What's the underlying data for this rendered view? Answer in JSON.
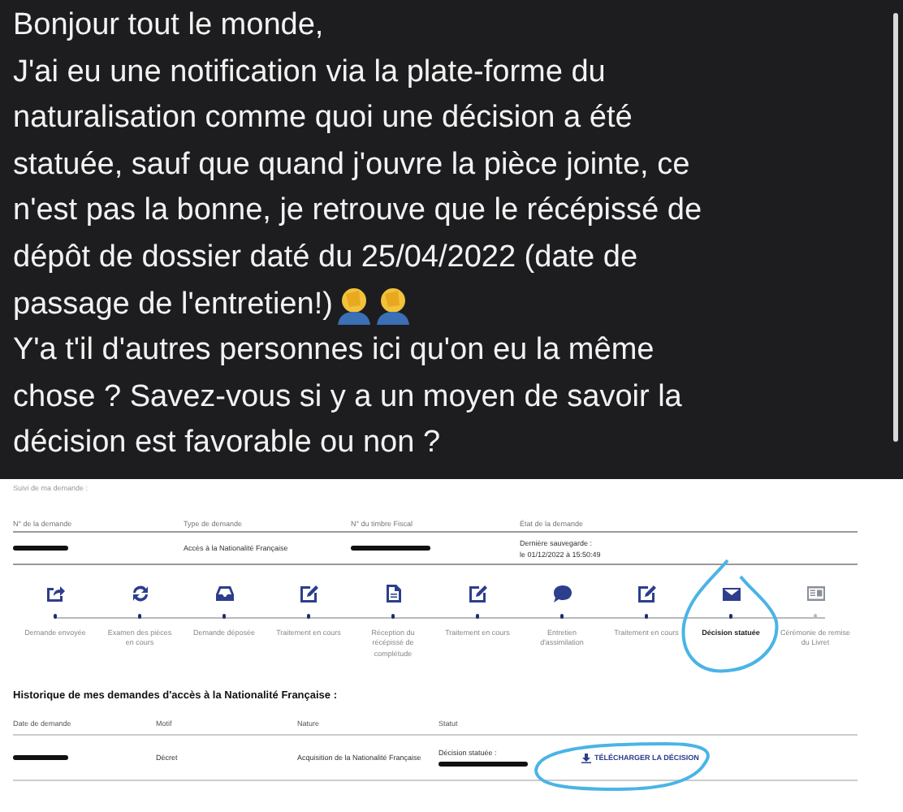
{
  "post": {
    "paragraphs": [
      [
        "Bonjour tout le monde,",
        "J'ai eu une notification via la plate-forme du",
        "naturalisation comme quoi une décision a été",
        "statuée, sauf que quand j'ouvre la pièce jointe, ce",
        "n'est pas la bonne, je retrouve que le récépissé de",
        "dépôt de dossier daté du 25/04/2022 (date de",
        "passage de l'entretien!)"
      ],
      [
        "Y'a t'il d'autres personnes ici qu'on eu la même",
        "chose ? Savez-vous si y a un moyen de savoir la",
        "décision est favorable ou non ?"
      ]
    ]
  },
  "tracking": {
    "title": "Suivi de ma demande :",
    "columns": [
      "N° de la demande",
      "Type de demande",
      "N° du timbre Fiscal",
      "État de la demande"
    ],
    "values": {
      "type": "Accès à la Nationalité Française",
      "state_label": "Dernière sauvegarde :",
      "state_value": "le 01/12/2022 à 15:50:49"
    },
    "steps": [
      {
        "kind": "share",
        "label": "Demande envoyée",
        "done": true,
        "selected": false
      },
      {
        "kind": "sync",
        "label": "Examen des pièces en cours",
        "done": true,
        "selected": false
      },
      {
        "kind": "inbox",
        "label": "Demande déposée",
        "done": true,
        "selected": false
      },
      {
        "kind": "edit",
        "label": "Traitement en cours",
        "done": true,
        "selected": false
      },
      {
        "kind": "document",
        "label": "Réception du récépissé de complétude",
        "done": true,
        "selected": false
      },
      {
        "kind": "edit",
        "label": "Traitement en cours",
        "done": true,
        "selected": false
      },
      {
        "kind": "chat",
        "label": "Entretien d'assimilation",
        "done": true,
        "selected": false
      },
      {
        "kind": "edit",
        "label": "Traitement en cours",
        "done": true,
        "selected": false
      },
      {
        "kind": "mail",
        "label": "Décision statuée",
        "done": true,
        "selected": true
      },
      {
        "kind": "card",
        "label": "Cérémonie de remise du Livret",
        "done": false,
        "selected": false
      }
    ]
  },
  "history": {
    "title": "Historique de mes demandes d'accès à la Nationalité Française :",
    "columns": [
      "Date de demande",
      "Motif",
      "Nature",
      "Statut"
    ],
    "rows": [
      {
        "motif": "Décret",
        "nature": "Acquisition de la Nationalité Française",
        "status": "Décision statuée :",
        "action": "TÉLÉCHARGER LA DÉCISION"
      }
    ]
  }
}
